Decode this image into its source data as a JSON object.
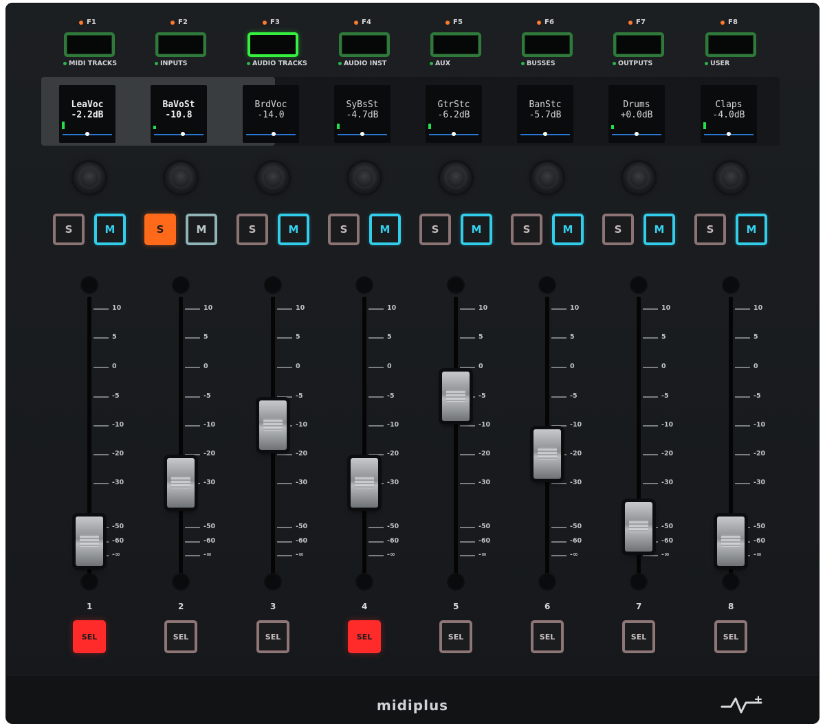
{
  "brand": {
    "name": "midiplus"
  },
  "function_keys": [
    {
      "key": "F1",
      "label": "MIDI TRACKS",
      "active": false
    },
    {
      "key": "F2",
      "label": "INPUTS",
      "active": false
    },
    {
      "key": "F3",
      "label": "AUDIO TRACKS",
      "active": true
    },
    {
      "key": "F4",
      "label": "AUDIO INST",
      "active": false
    },
    {
      "key": "F5",
      "label": "AUX",
      "active": false
    },
    {
      "key": "F6",
      "label": "BUSSES",
      "active": false
    },
    {
      "key": "F7",
      "label": "OUTPUTS",
      "active": false
    },
    {
      "key": "F8",
      "label": "USER",
      "active": false
    }
  ],
  "channels": [
    {
      "number": "1",
      "display_name": "LeaVoc",
      "display_value": "-2.2dB",
      "solo": false,
      "mute": true,
      "selected": true,
      "solo_label": "S",
      "mute_label": "M",
      "sel_label": "SEL",
      "fader_db": -60,
      "pan": 0.5,
      "meter": 0.18
    },
    {
      "number": "2",
      "display_name": "BaVoSt",
      "display_value": "-10.8",
      "solo": true,
      "mute": false,
      "selected": false,
      "solo_label": "S",
      "mute_label": "M",
      "sel_label": "SEL",
      "fader_db": -30,
      "pan": 0.58,
      "meter": 0.08
    },
    {
      "number": "3",
      "display_name": "BrdVoc",
      "display_value": "-14.0",
      "solo": false,
      "mute": true,
      "selected": false,
      "solo_label": "S",
      "mute_label": "M",
      "sel_label": "SEL",
      "fader_db": -10,
      "pan": 0.56,
      "meter": 0.0
    },
    {
      "number": "4",
      "display_name": "SyBsSt",
      "display_value": "-4.7dB",
      "solo": false,
      "mute": true,
      "selected": true,
      "solo_label": "S",
      "mute_label": "M",
      "sel_label": "SEL",
      "fader_db": -30,
      "pan": 0.5,
      "meter": 0.14
    },
    {
      "number": "5",
      "display_name": "GtrStc",
      "display_value": "-6.2dB",
      "solo": false,
      "mute": true,
      "selected": false,
      "solo_label": "S",
      "mute_label": "M",
      "sel_label": "SEL",
      "fader_db": -5,
      "pan": 0.5,
      "meter": 0.14
    },
    {
      "number": "6",
      "display_name": "BanStc",
      "display_value": "-5.7dB",
      "solo": false,
      "mute": true,
      "selected": false,
      "solo_label": "S",
      "mute_label": "M",
      "sel_label": "SEL",
      "fader_db": -20,
      "pan": 0.5,
      "meter": 0.0
    },
    {
      "number": "7",
      "display_name": "Drums",
      "display_value": "+0.0dB",
      "solo": false,
      "mute": true,
      "selected": false,
      "solo_label": "S",
      "mute_label": "M",
      "sel_label": "SEL",
      "fader_db": -50,
      "pan": 0.5,
      "meter": 0.1
    },
    {
      "number": "8",
      "display_name": "Claps",
      "display_value": "-4.0dB",
      "solo": false,
      "mute": true,
      "selected": false,
      "solo_label": "S",
      "mute_label": "M",
      "sel_label": "SEL",
      "fader_db": -60,
      "pan": 0.5,
      "meter": 0.16
    }
  ],
  "fader_scale": [
    "10",
    "5",
    "0",
    "-5",
    "-10",
    "-20",
    "-30",
    "-50",
    "-60",
    "-∞"
  ],
  "colors": {
    "panel": "#1c1f22",
    "function_border": "#2f7a3a",
    "function_active": "#35f03f",
    "solo_on": "#ff6a1a",
    "mute_on": "#32cdea",
    "select_on": "#ff2a2a",
    "pan_line": "#2a78d6"
  }
}
